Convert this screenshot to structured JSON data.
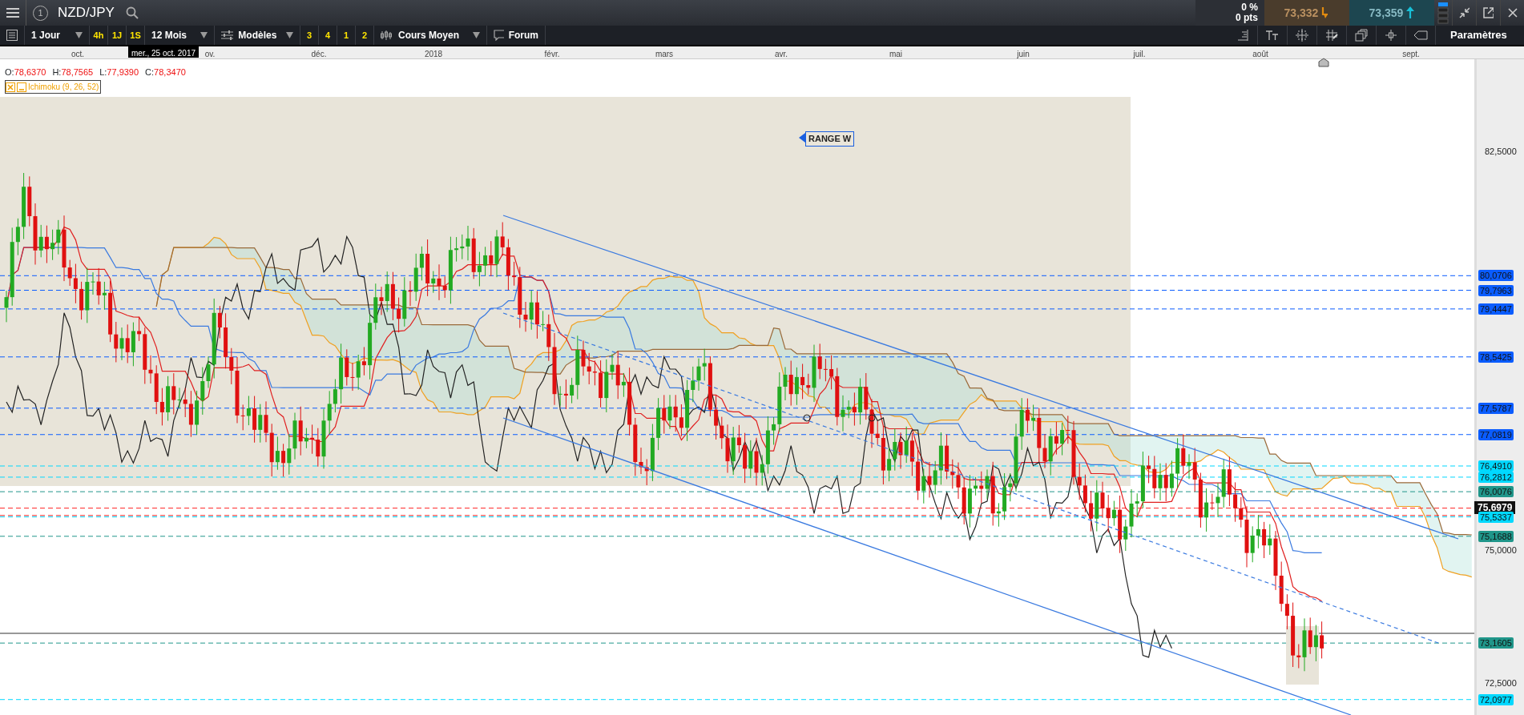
{
  "top_bar": {
    "badge": "1",
    "symbol": "NZD/JPY",
    "change_percent": "0 %",
    "change_pts": "0 pts",
    "sell_price": "73,332",
    "buy_price": "73,359"
  },
  "toolbar": {
    "period": "1 Jour",
    "intervals": [
      {
        "label": "4h"
      },
      {
        "label": "1J"
      },
      {
        "label": "1S"
      }
    ],
    "range": "12 Mois",
    "templates": "Modèles",
    "layouts": [
      {
        "label": "3"
      },
      {
        "label": "4"
      },
      {
        "label": "1"
      },
      {
        "label": "2"
      }
    ],
    "chart_type": "Cours Moyen",
    "forum": "Forum",
    "settings": "Paramètres"
  },
  "time_axis": {
    "months": [
      "oct.",
      "ov.",
      "déc.",
      "2018",
      "févr.",
      "mars",
      "avr.",
      "mai",
      "juin",
      "juil.",
      "août",
      "sept."
    ],
    "tooltip": "mer., 25 oct. 2017"
  },
  "legend": {
    "ohlc": [
      {
        "key": "O:",
        "value": "78,6370"
      },
      {
        "key": "H:",
        "value": "78,7565"
      },
      {
        "key": "L:",
        "value": "77,9390"
      },
      {
        "key": "C:",
        "value": "78,3470"
      }
    ],
    "indicator": "Ichimoku (9, 26, 52)"
  },
  "annotation": "RANGE W",
  "price_axis": {
    "ticks": [
      "82,5000",
      "75,0000",
      "72,5000"
    ],
    "levels": [
      {
        "price": "80,0706",
        "color": "#0a5cff",
        "kind": "level"
      },
      {
        "price": "79,7963",
        "color": "#0a5cff",
        "kind": "level"
      },
      {
        "price": "79,4447",
        "color": "#0a5cff",
        "kind": "level"
      },
      {
        "price": "78,5425",
        "color": "#0a5cff",
        "kind": "level"
      },
      {
        "price": "77,5787",
        "color": "#0a5cff",
        "kind": "level"
      },
      {
        "price": "77,0819",
        "color": "#0a5cff",
        "kind": "level"
      },
      {
        "price": "76,4910",
        "color": "#00d8ff",
        "kind": "level"
      },
      {
        "price": "76,2812",
        "color": "#00d8ff",
        "kind": "level"
      },
      {
        "price": "76,0076",
        "color": "#20968a",
        "kind": "level"
      },
      {
        "price": "75,6979",
        "color": "#111111",
        "kind": "current"
      },
      {
        "price": "75,5337",
        "color": "#00d8ff",
        "kind": "level"
      },
      {
        "price": "75,1688",
        "color": "#20968a",
        "kind": "level"
      },
      {
        "price": "73,1605",
        "color": "#20968a",
        "kind": "level"
      },
      {
        "price": "72,0977",
        "color": "#00d8ff",
        "kind": "level"
      }
    ]
  }
}
